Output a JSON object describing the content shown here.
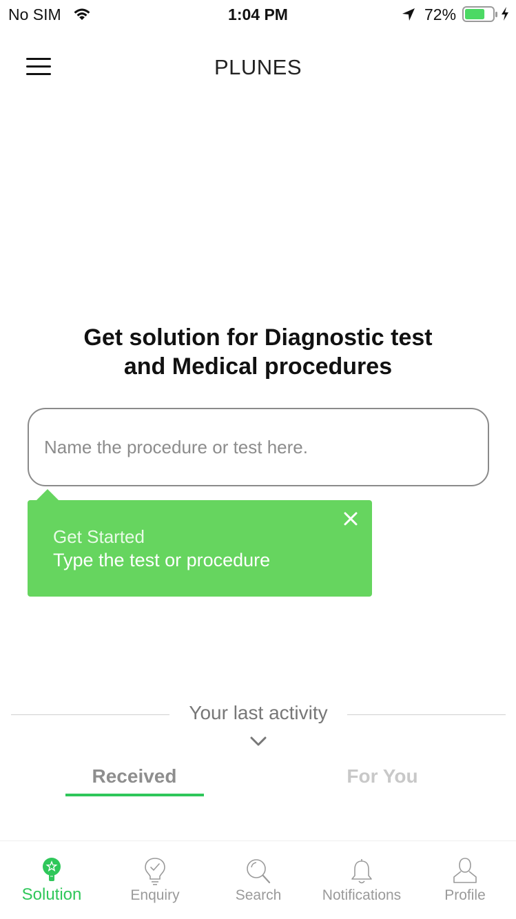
{
  "status_bar": {
    "carrier": "No SIM",
    "time": "1:04 PM",
    "battery_percent": "72%",
    "battery_level": 0.72,
    "battery_color": "#4cd964"
  },
  "header": {
    "title": "PLUNES",
    "menu_icon": "hamburger-menu-icon"
  },
  "main": {
    "headline_line1": "Get solution for Diagnostic test",
    "headline_line2": "and Medical procedures",
    "search_placeholder": "Name the procedure or test here."
  },
  "tooltip": {
    "title": "Get Started",
    "text": "Type the test or procedure",
    "background_color": "#66d55f"
  },
  "activity": {
    "title": "Your last activity",
    "tabs": [
      {
        "label": "Received",
        "selected": true
      },
      {
        "label": "For You",
        "selected": false
      }
    ]
  },
  "tabbar": {
    "accent_color": "#2fc75a",
    "items": [
      {
        "label": "Solution",
        "icon": "lightbulb-star-icon",
        "active": true
      },
      {
        "label": "Enquiry",
        "icon": "lightbulb-check-icon",
        "active": false
      },
      {
        "label": "Search",
        "icon": "magnifier-icon",
        "active": false
      },
      {
        "label": "Notifications",
        "icon": "bell-icon",
        "active": false
      },
      {
        "label": "Profile",
        "icon": "person-icon",
        "active": false
      }
    ]
  }
}
